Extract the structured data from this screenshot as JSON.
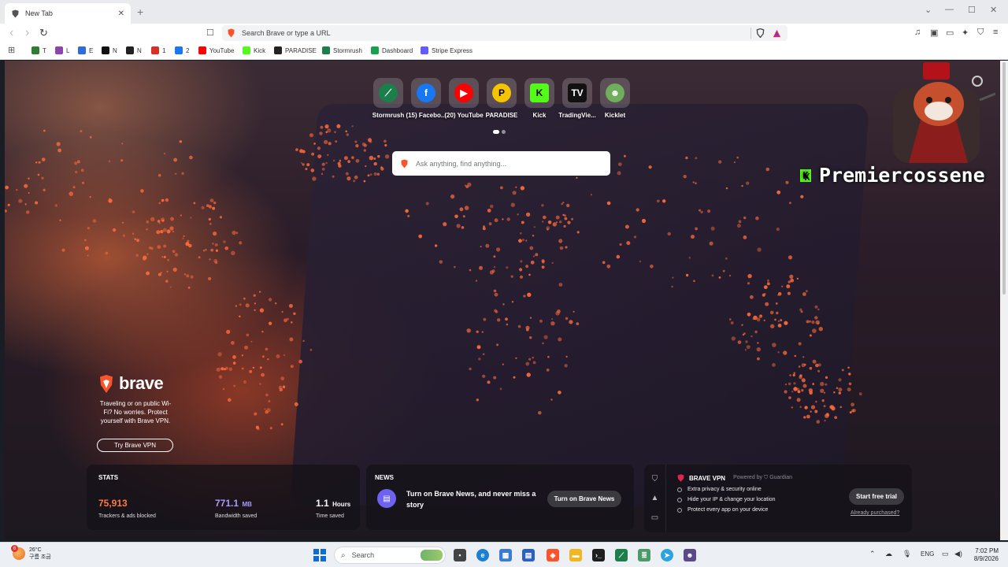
{
  "tab": {
    "title": "New Tab",
    "close": "✕",
    "new": "+"
  },
  "window": {
    "minimize": "—",
    "maximize": "☐",
    "close": "✕",
    "tabsearch": "⌄"
  },
  "toolbar": {
    "back": "‹",
    "forward": "›",
    "reload": "↻",
    "bookmark": "☐",
    "url_placeholder": "Search Brave or type a URL",
    "icons": [
      "music-icon",
      "sidebar-icon",
      "wallet-icon",
      "leo-icon",
      "vpn-icon",
      "menu-icon"
    ]
  },
  "bookmarks": [
    {
      "label": "T",
      "icon": "cloverleaf-icon",
      "color": "#2e7d32"
    },
    {
      "label": "L",
      "icon": "l-icon",
      "color": "#8e44ad"
    },
    {
      "label": "E",
      "icon": "e-icon",
      "color": "#2d6cdf"
    },
    {
      "label": "N",
      "icon": "tradingview-icon",
      "color": "#111111"
    },
    {
      "label": "N",
      "icon": "notion-icon",
      "color": "#222222"
    },
    {
      "label": "1",
      "icon": "gmail-icon",
      "color": "#d93025"
    },
    {
      "label": "2",
      "icon": "facebook-icon",
      "color": "#1877f2"
    },
    {
      "label": "YouTube",
      "icon": "youtube-icon",
      "color": "#ff0000"
    },
    {
      "label": "Kick",
      "icon": "kick-icon",
      "color": "#53fc18"
    },
    {
      "label": "PARADISE",
      "icon": "paradise-icon",
      "color": "#222222"
    },
    {
      "label": "Stormrush",
      "icon": "stormrush-icon",
      "color": "#1a7f4b"
    },
    {
      "label": "Dashboard",
      "icon": "dashboard-icon",
      "color": "#16a34a"
    },
    {
      "label": "Stripe Express",
      "icon": "stripe-icon",
      "color": "#635bff"
    }
  ],
  "topsites": [
    {
      "label": "Stormrush",
      "icon": "stormrush-icon",
      "glyph": "⟋",
      "bg": "#1a7f4b"
    },
    {
      "label": "(15) Facebo...",
      "icon": "facebook-icon",
      "glyph": "f",
      "bg": "#1877f2"
    },
    {
      "label": "(20) YouTube",
      "icon": "youtube-icon",
      "glyph": "▶",
      "bg": "#ff0000"
    },
    {
      "label": "PARADISE",
      "icon": "paradise-icon",
      "glyph": "P",
      "bg": "#f5c400"
    },
    {
      "label": "Kick",
      "icon": "kick-icon",
      "glyph": "K",
      "bg": "#53fc18"
    },
    {
      "label": "TradingVie...",
      "icon": "tradingview-icon",
      "glyph": "TV",
      "bg": "#111111"
    },
    {
      "label": "Kicklet",
      "icon": "kicklet-icon",
      "glyph": "☻",
      "bg": "#6fae5a"
    }
  ],
  "search": {
    "placeholder": "Ask anything, find anything..."
  },
  "overlay": {
    "streamer_name": "Premiercossene",
    "badge": "K"
  },
  "promo": {
    "brand": "brave",
    "text": "Traveling or on public Wi-Fi? No worries. Protect yourself with Brave VPN.",
    "button": "Try Brave VPN"
  },
  "stats": {
    "title": "STATS",
    "trackers": {
      "value": "75,913",
      "label": "Trackers & ads blocked"
    },
    "bandwidth": {
      "value": "771.1",
      "unit": "MB",
      "label": "Bandwidth saved"
    },
    "time": {
      "value": "1.1",
      "unit": "Hours",
      "label": "Time saved"
    }
  },
  "news": {
    "title": "NEWS",
    "text": "Turn on Brave News, and never miss a story",
    "button": "Turn on Brave News"
  },
  "vpn": {
    "title": "BRAVE VPN",
    "powered": "Powered by ⛉ Guardian",
    "features": [
      "Extra privacy & security online",
      "Hide your IP & change your location",
      "Protect every app on your device"
    ],
    "button": "Start free trial",
    "link": "Already purchased?"
  },
  "taskbar": {
    "weather_temp": "26°C",
    "weather_desc": "구름 조금",
    "weather_badge": "6",
    "search": "Search",
    "lang": "ENG",
    "time": "7:02 PM",
    "date": "8/9/2026"
  },
  "colors": {
    "accent": "#ff5c2a",
    "kick": "#53fc18",
    "vpn_purple": "#6e62f0"
  }
}
